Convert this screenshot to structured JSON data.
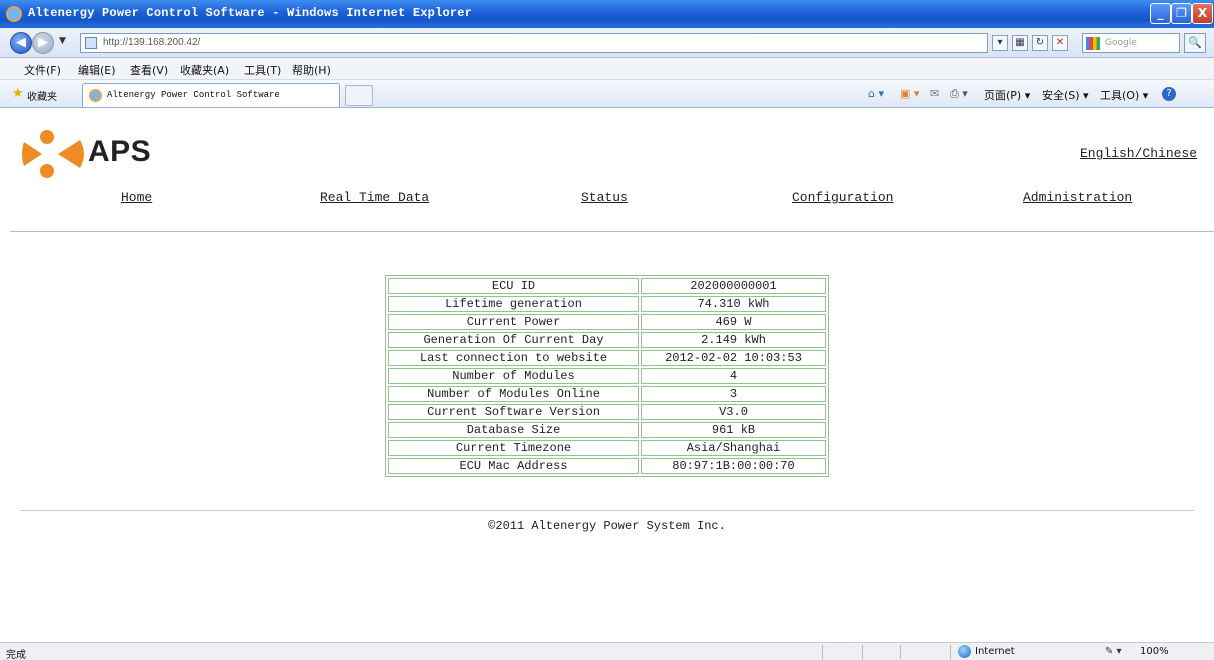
{
  "window": {
    "title": "Altenergy Power Control Software - Windows Internet Explorer",
    "minimize": "_",
    "maximize": "❐",
    "close": "X"
  },
  "addressbar": {
    "url": "http://139.168.200.42/",
    "search_placeholder": "Google",
    "search_glyph": "🔍"
  },
  "menu": {
    "items": [
      "文件(F)",
      "编辑(E)",
      "查看(V)",
      "收藏夹(A)",
      "工具(T)",
      "帮助(H)"
    ]
  },
  "favorites": {
    "label": "收藏夹",
    "tab_title": "Altenergy Power Control Software"
  },
  "commandbar": {
    "page": "页面(P) ▾",
    "safety": "安全(S) ▾",
    "tools": "工具(O) ▾",
    "help": "?"
  },
  "header": {
    "logo_text": "APS",
    "language": "English/Chinese"
  },
  "nav": {
    "items": [
      "Home",
      "Real Time Data",
      "Status",
      "Configuration",
      "Administration"
    ]
  },
  "info_table": [
    {
      "label": "ECU ID",
      "value": "202000000001"
    },
    {
      "label": "Lifetime generation",
      "value": "74.310 kWh"
    },
    {
      "label": "Current Power",
      "value": "469 W"
    },
    {
      "label": "Generation Of Current Day",
      "value": "2.149 kWh"
    },
    {
      "label": "Last connection to website",
      "value": "2012-02-02 10:03:53"
    },
    {
      "label": "Number of Modules",
      "value": "4"
    },
    {
      "label": "Number of Modules Online",
      "value": "3"
    },
    {
      "label": "Current Software Version",
      "value": "V3.0"
    },
    {
      "label": "Database Size",
      "value": "961 kB"
    },
    {
      "label": "Current Timezone",
      "value": "Asia/Shanghai"
    },
    {
      "label": "ECU Mac Address",
      "value": "80:97:1B:00:00:70"
    }
  ],
  "footer": {
    "copyright": "©2011 Altenergy Power System Inc."
  },
  "statusbar": {
    "status": "完成",
    "zone": "Internet",
    "zoom": "100%"
  },
  "colors": {
    "logo_orange": "#f08a24",
    "table_border": "#8fc48f",
    "titlebar_blue": "#1c5fd8"
  }
}
